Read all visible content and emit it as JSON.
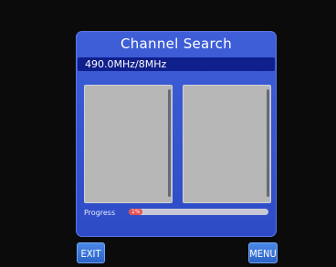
{
  "dialog": {
    "title": "Channel Search",
    "frequency": "490.0MHz/8MHz"
  },
  "progress": {
    "label": "Progress",
    "value_text": "1%",
    "fraction": 0.1
  },
  "buttons": {
    "exit": "EXIT",
    "menu": "MENU"
  },
  "colors": {
    "dialog_blue": "#3554cf",
    "frequency_bar": "#0f1f8c",
    "panel_gray": "#b7b7b7",
    "progress_fill": "#e85050"
  }
}
